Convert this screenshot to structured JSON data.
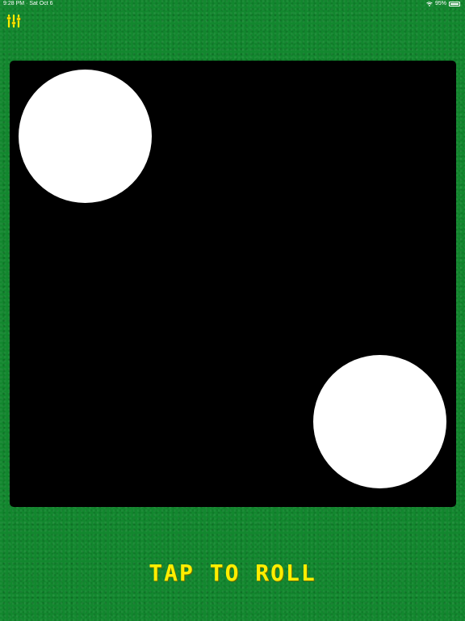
{
  "status_bar": {
    "time": "9:28 PM",
    "date": "Sat Oct 6",
    "battery": "95%",
    "battery_level": 0.95
  },
  "toolbar": {
    "settings_icon": "sliders-icon"
  },
  "die": {
    "value": 2,
    "pips": [
      "top-left",
      "bottom-right"
    ]
  },
  "roll": {
    "label": "TAP TO ROLL",
    "color": "#ffee00"
  },
  "colors": {
    "felt": "#12872e",
    "die": "#000000",
    "pip": "#ffffff"
  }
}
